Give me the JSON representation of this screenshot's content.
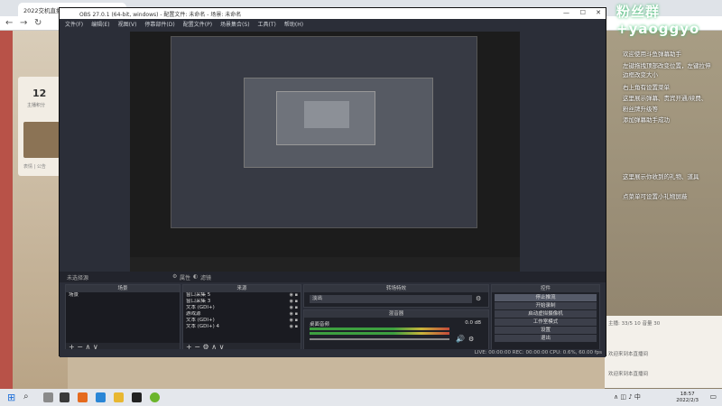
{
  "browser": {
    "tab_title": "2022交机直播间地板",
    "back_label": "←",
    "forward_label": "→",
    "reload_label": "↻",
    "card_number": "12",
    "card_label": "主播积分",
    "card_sub": "表情 | 公告"
  },
  "overlay": {
    "watermark": "粉丝群+yaoggyo",
    "danmaku": [
      "欢迎使用斗鱼弹幕助手",
      "左键拖拽顶部改变位置，左键拉伸",
      "边框改变大小",
      "右上角有设置菜单",
      "这里展示弹幕、贵宾开通/续费、",
      "粉丝牌升级等",
      "添加弹幕助手成功",
      "这里展示你收到的礼物、道具",
      "点菜单可设置小礼物屏蔽"
    ],
    "chat": [
      "主播: 33/5 10 音量 30",
      "欢迎来到本直播间",
      "欢迎来到本直播间"
    ]
  },
  "obs": {
    "title": "OBS 27.0.1 (64-bit, windows) - 配置文件: 未命名 - 场景: 未命名",
    "menu": [
      "文件(F)",
      "编辑(E)",
      "视图(V)",
      "停靠部件(D)",
      "配置文件(P)",
      "场景集合(S)",
      "工具(T)",
      "帮助(H)"
    ],
    "mode_label": "未选择源",
    "mode_props": "属性",
    "mode_filters": "滤镜",
    "scenes_title": "场景",
    "scenes": [
      "场景"
    ],
    "sources_title": "来源",
    "sources": [
      "窗口采集 5",
      "窗口采集 3",
      "文本 (GDI+)",
      "游戏源",
      "文本 (GDI+)",
      "文本 (GDI+) 4"
    ],
    "transition_title": "转场特效",
    "transition_value": "淡出",
    "mixer_title": "混音器",
    "mixer_track": "桌面音频",
    "mixer_db": "0.0 dB",
    "controls_title": "控件",
    "controls": [
      "停止推流",
      "开始录制",
      "启动虚拟摄像机",
      "工作室模式",
      "设置",
      "退出"
    ],
    "status": "LIVE: 00:00:00   REC: 00:00:00   CPU: 0.6%, 60.00 fps",
    "add": "+",
    "remove": "−",
    "up": "∧",
    "down": "∨"
  },
  "taskbar": {
    "time": "18:57",
    "date": "2022/2/3"
  }
}
